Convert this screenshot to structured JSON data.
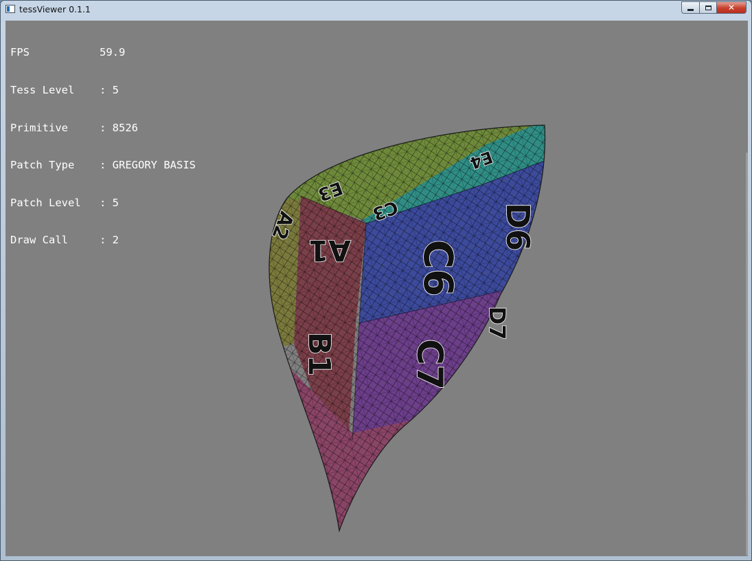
{
  "window": {
    "title": "tessViewer 0.1.1",
    "close_glyph": "✕"
  },
  "hud": [
    {
      "label": "FPS",
      "value": "59.9"
    },
    {
      "label": "Tess Level",
      "value": ": 5"
    },
    {
      "label": "Primitive",
      "value": ": 8526"
    },
    {
      "label": "Patch Type",
      "value": ": GREGORY BASIS"
    },
    {
      "label": "Patch Level",
      "value": ": 5"
    },
    {
      "label": "Draw Call",
      "value": ": 2"
    }
  ],
  "model": {
    "labels": [
      "E3",
      "E4",
      "C3",
      "A1",
      "C6",
      "D6",
      "B1",
      "C7",
      "D7",
      "A2"
    ],
    "colors": {
      "green": "#6e8a3a",
      "teal": "#2f8e86",
      "blue": "#3c4a9c",
      "purple": "#6c3e8a",
      "maroon": "#7a3e48",
      "pink": "#8a4466",
      "olive": "#7b7a3c",
      "background": "#808080"
    }
  }
}
